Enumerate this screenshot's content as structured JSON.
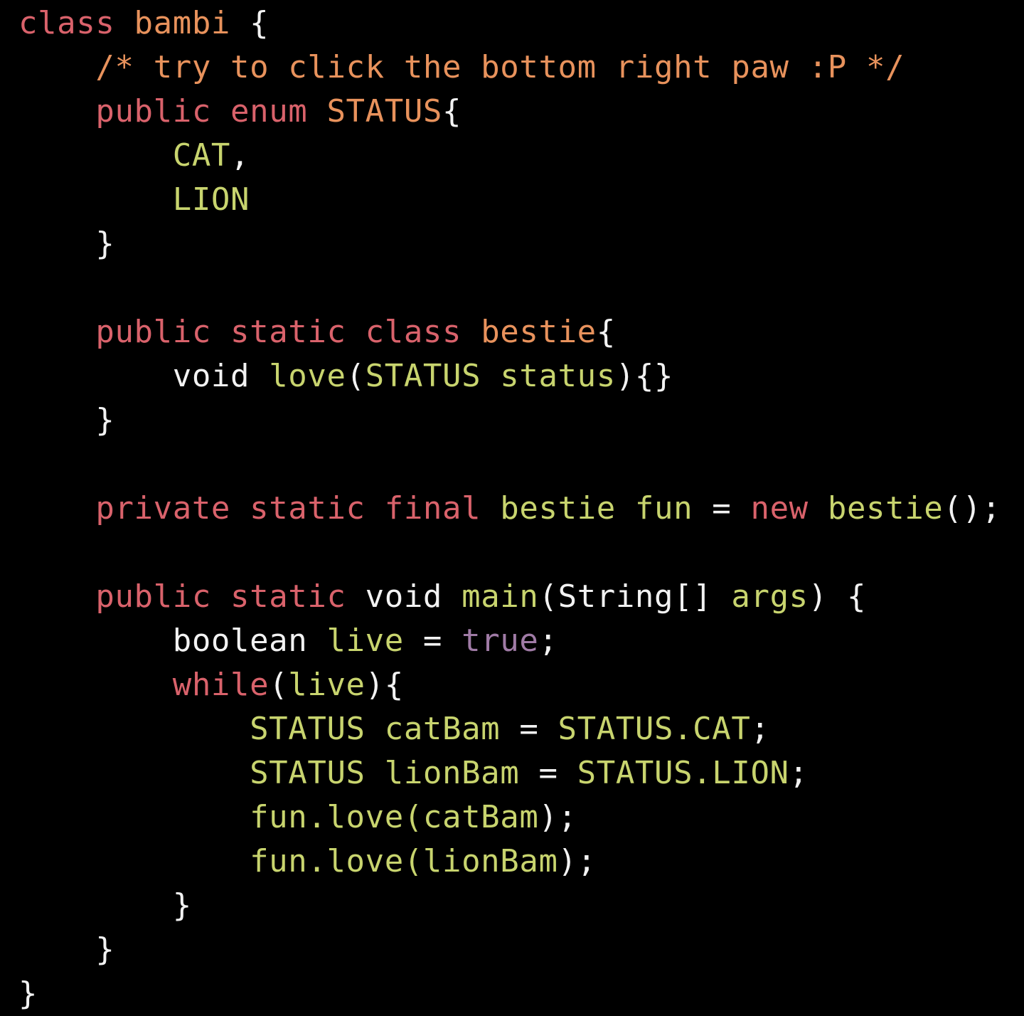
{
  "colors": {
    "background": "#000000",
    "keyword": "#d9626b",
    "class_name": "#e8925c",
    "comment": "#e8925c",
    "identifier": "#c8d46e",
    "plain": "#f2f2f2",
    "boolean_literal": "#a07ba6"
  },
  "lines": [
    {
      "indent": 0,
      "tokens": [
        {
          "text": "class ",
          "kind": "keyword"
        },
        {
          "text": "bambi",
          "kind": "class_name"
        },
        {
          "text": " {",
          "kind": "plain"
        }
      ]
    },
    {
      "indent": 1,
      "tokens": [
        {
          "text": "/* try to click the bottom right paw :P */",
          "kind": "comment"
        }
      ]
    },
    {
      "indent": 1,
      "tokens": [
        {
          "text": "public ",
          "kind": "keyword"
        },
        {
          "text": "enum ",
          "kind": "keyword"
        },
        {
          "text": "STATUS",
          "kind": "class_name"
        },
        {
          "text": "{",
          "kind": "plain"
        }
      ]
    },
    {
      "indent": 2,
      "tokens": [
        {
          "text": "CAT",
          "kind": "identifier"
        },
        {
          "text": ",",
          "kind": "plain"
        }
      ]
    },
    {
      "indent": 2,
      "tokens": [
        {
          "text": "LION",
          "kind": "identifier"
        }
      ]
    },
    {
      "indent": 1,
      "tokens": [
        {
          "text": "}",
          "kind": "plain"
        }
      ]
    },
    {
      "indent": 0,
      "tokens": []
    },
    {
      "indent": 1,
      "tokens": [
        {
          "text": "public ",
          "kind": "keyword"
        },
        {
          "text": "static ",
          "kind": "keyword"
        },
        {
          "text": "class ",
          "kind": "keyword"
        },
        {
          "text": "bestie",
          "kind": "class_name"
        },
        {
          "text": "{",
          "kind": "plain"
        }
      ]
    },
    {
      "indent": 2,
      "tokens": [
        {
          "text": "void ",
          "kind": "plain"
        },
        {
          "text": "love",
          "kind": "identifier"
        },
        {
          "text": "(",
          "kind": "plain"
        },
        {
          "text": "STATUS status",
          "kind": "identifier"
        },
        {
          "text": "){}",
          "kind": "plain"
        }
      ]
    },
    {
      "indent": 1,
      "tokens": [
        {
          "text": "}",
          "kind": "plain"
        }
      ]
    },
    {
      "indent": 0,
      "tokens": []
    },
    {
      "indent": 1,
      "tokens": [
        {
          "text": "private ",
          "kind": "keyword"
        },
        {
          "text": "static ",
          "kind": "keyword"
        },
        {
          "text": "final ",
          "kind": "keyword"
        },
        {
          "text": "bestie fun ",
          "kind": "identifier"
        },
        {
          "text": "= ",
          "kind": "plain"
        },
        {
          "text": "new ",
          "kind": "keyword"
        },
        {
          "text": "bestie",
          "kind": "identifier"
        },
        {
          "text": "();",
          "kind": "plain"
        }
      ]
    },
    {
      "indent": 0,
      "tokens": []
    },
    {
      "indent": 1,
      "tokens": [
        {
          "text": "public ",
          "kind": "keyword"
        },
        {
          "text": "static ",
          "kind": "keyword"
        },
        {
          "text": "void ",
          "kind": "plain"
        },
        {
          "text": "main",
          "kind": "identifier"
        },
        {
          "text": "(String[] ",
          "kind": "plain"
        },
        {
          "text": "args",
          "kind": "identifier"
        },
        {
          "text": ") {",
          "kind": "plain"
        }
      ]
    },
    {
      "indent": 2,
      "tokens": [
        {
          "text": "boolean ",
          "kind": "plain"
        },
        {
          "text": "live ",
          "kind": "identifier"
        },
        {
          "text": "= ",
          "kind": "plain"
        },
        {
          "text": "true",
          "kind": "boolean_literal"
        },
        {
          "text": ";",
          "kind": "plain"
        }
      ]
    },
    {
      "indent": 2,
      "tokens": [
        {
          "text": "while",
          "kind": "keyword"
        },
        {
          "text": "(",
          "kind": "plain"
        },
        {
          "text": "live",
          "kind": "identifier"
        },
        {
          "text": "){",
          "kind": "plain"
        }
      ]
    },
    {
      "indent": 3,
      "tokens": [
        {
          "text": "STATUS catBam ",
          "kind": "identifier"
        },
        {
          "text": "= ",
          "kind": "plain"
        },
        {
          "text": "STATUS.CAT",
          "kind": "identifier"
        },
        {
          "text": ";",
          "kind": "plain"
        }
      ]
    },
    {
      "indent": 3,
      "tokens": [
        {
          "text": "STATUS lionBam ",
          "kind": "identifier"
        },
        {
          "text": "= ",
          "kind": "plain"
        },
        {
          "text": "STATUS.LION",
          "kind": "identifier"
        },
        {
          "text": ";",
          "kind": "plain"
        }
      ]
    },
    {
      "indent": 3,
      "tokens": [
        {
          "text": "fun.love(catBam",
          "kind": "identifier"
        },
        {
          "text": ");",
          "kind": "plain"
        }
      ]
    },
    {
      "indent": 3,
      "tokens": [
        {
          "text": "fun.love(lionBam",
          "kind": "identifier"
        },
        {
          "text": ");",
          "kind": "plain"
        }
      ]
    },
    {
      "indent": 2,
      "tokens": [
        {
          "text": "}",
          "kind": "plain"
        }
      ]
    },
    {
      "indent": 1,
      "tokens": [
        {
          "text": "}",
          "kind": "plain"
        }
      ]
    },
    {
      "indent": 0,
      "tokens": [
        {
          "text": "}",
          "kind": "plain"
        }
      ]
    }
  ]
}
